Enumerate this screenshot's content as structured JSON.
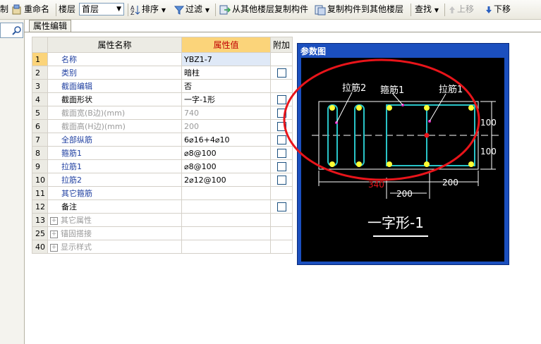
{
  "toolbar": {
    "copy_partial": "制",
    "rename": "重命名",
    "floor_label": "楼层",
    "floor_value": "首层",
    "sort": "排序",
    "filter": "过滤",
    "copy_from": "从其他楼层复制构件",
    "copy_to": "复制构件到其他楼层",
    "find": "查找",
    "move_up": "上移",
    "move_down": "下移"
  },
  "tab": {
    "label": "属性编辑"
  },
  "grid": {
    "headers": {
      "name": "属性名称",
      "value": "属性值",
      "extra": "附加"
    },
    "rows": [
      {
        "num": "1",
        "name": "名称",
        "value": "YBZ1-7",
        "check": false
      },
      {
        "num": "2",
        "name": "类别",
        "value": "暗柱",
        "check": true
      },
      {
        "num": "3",
        "name": "截面编辑",
        "value": "否",
        "check": false
      },
      {
        "num": "4",
        "name": "截面形状",
        "value": "一字-1形",
        "check": true
      },
      {
        "num": "5",
        "name": "截面宽(B边)(mm)",
        "value": "740",
        "check": true
      },
      {
        "num": "6",
        "name": "截面高(H边)(mm)",
        "value": "200",
        "check": true
      },
      {
        "num": "7",
        "name": "全部纵筋",
        "value": "6⌀16+4⌀10",
        "check": true
      },
      {
        "num": "8",
        "name": "箍筋1",
        "value": "⌀8@100",
        "check": true
      },
      {
        "num": "9",
        "name": "拉筋1",
        "value": "⌀8@100",
        "check": true
      },
      {
        "num": "10",
        "name": "拉筋2",
        "value": "2⌀12@100",
        "check": true
      },
      {
        "num": "11",
        "name": "其它箍筋",
        "value": "",
        "check": false
      },
      {
        "num": "12",
        "name": "备注",
        "value": "",
        "check": true
      },
      {
        "num": "13",
        "name": "其它属性",
        "value": "",
        "check": false
      },
      {
        "num": "25",
        "name": "锚固搭接",
        "value": "",
        "check": false
      },
      {
        "num": "40",
        "name": "显示样式",
        "value": "",
        "check": false
      }
    ]
  },
  "reference": {
    "title": "参数图",
    "label_lajin2": "拉筋2",
    "label_gujin1": "箍筋1",
    "label_lajin1": "拉筋1",
    "dim_100_top": "100",
    "dim_100_bottom": "100",
    "dim_340": "340",
    "dim_200_left": "200",
    "dim_200_right": "200",
    "shape_caption": "一字形-1"
  },
  "colors": {
    "highlight": "#fbd47a",
    "title_bar": "#1b4fbe",
    "rebar": "#29c4c8",
    "bar_point": "#ffff33",
    "circle": "#e8141a"
  }
}
